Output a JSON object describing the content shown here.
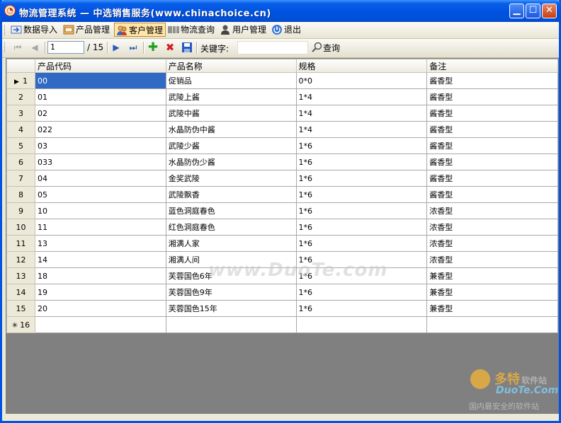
{
  "window": {
    "title": "物流管理系统 — 中选销售服务(www.chinachoice.cn)",
    "title_icon": "clock-icon",
    "controls": [
      "minimize",
      "maximize",
      "close"
    ]
  },
  "menu": {
    "items": [
      {
        "label": "数据导入",
        "icon": "import-icon"
      },
      {
        "label": "产品管理",
        "icon": "product-icon"
      },
      {
        "label": "客户管理",
        "icon": "customers-icon",
        "active": true
      },
      {
        "label": "物流查询",
        "icon": "barcode-icon"
      },
      {
        "label": "用户管理",
        "icon": "user-icon"
      },
      {
        "label": "退出",
        "icon": "power-icon"
      }
    ]
  },
  "navigator": {
    "position": "1",
    "total": "/ 15",
    "keyword_label": "关键字:",
    "keyword_value": "",
    "search_label": "查询"
  },
  "grid": {
    "columns": [
      "产品代码",
      "产品名称",
      "规格",
      "备注"
    ],
    "rows": [
      {
        "no": "1",
        "code": "00",
        "name": "促销品",
        "spec": "0*0",
        "note": "酱香型"
      },
      {
        "no": "2",
        "code": "01",
        "name": "武陵上酱",
        "spec": "1*4",
        "note": "酱香型"
      },
      {
        "no": "3",
        "code": "02",
        "name": "武陵中酱",
        "spec": "1*4",
        "note": "酱香型"
      },
      {
        "no": "4",
        "code": "022",
        "name": "水晶防伪中酱",
        "spec": "1*4",
        "note": "酱香型"
      },
      {
        "no": "5",
        "code": "03",
        "name": "武陵少酱",
        "spec": "1*6",
        "note": "酱香型"
      },
      {
        "no": "6",
        "code": "033",
        "name": "水晶防伪少酱",
        "spec": "1*6",
        "note": "酱香型"
      },
      {
        "no": "7",
        "code": "04",
        "name": "金奖武陵",
        "spec": "1*6",
        "note": "酱香型"
      },
      {
        "no": "8",
        "code": "05",
        "name": "武陵飘香",
        "spec": "1*6",
        "note": "酱香型"
      },
      {
        "no": "9",
        "code": "10",
        "name": "蓝色洞庭春色",
        "spec": "1*6",
        "note": "浓香型"
      },
      {
        "no": "10",
        "code": "11",
        "name": "红色洞庭春色",
        "spec": "1*6",
        "note": "浓香型"
      },
      {
        "no": "11",
        "code": "13",
        "name": "湘满人家",
        "spec": "1*6",
        "note": "浓香型"
      },
      {
        "no": "12",
        "code": "14",
        "name": "湘满人间",
        "spec": "1*6",
        "note": "浓香型"
      },
      {
        "no": "13",
        "code": "18",
        "name": "芙蓉国色6年",
        "spec": "1*6",
        "note": "兼香型"
      },
      {
        "no": "14",
        "code": "19",
        "name": "芙蓉国色9年",
        "spec": "1*6",
        "note": "兼香型"
      },
      {
        "no": "15",
        "code": "20",
        "name": "芙蓉国色15年",
        "spec": "1*6",
        "note": "兼香型"
      }
    ],
    "new_row_no": "16",
    "current_row_marker": "▶",
    "new_row_marker": "✳"
  },
  "watermark": "www.DuoTe.com",
  "logo": {
    "name": "多特",
    "tag": "软件站",
    "domain": "DuoTe.Com",
    "slogan": "国内最安全的软件站"
  },
  "colors": {
    "title_bar": "#0053e1",
    "selection": "#316ac5",
    "empty_area": "#808080"
  }
}
